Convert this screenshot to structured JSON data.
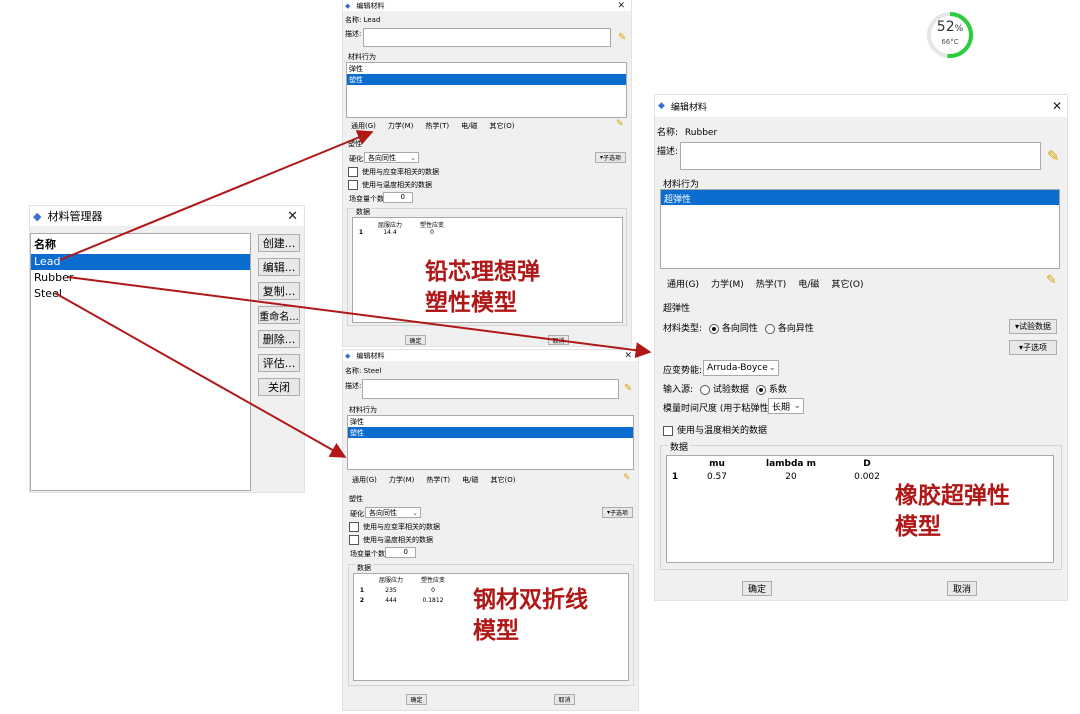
{
  "colors": {
    "selection": "#0a6ccf",
    "annotation": "#b01818",
    "arrow": "#b01818",
    "gauge": "#2ecc40"
  },
  "gauge": {
    "percent_value": 52,
    "percent_unit": "%",
    "temp": "66°C"
  },
  "manager": {
    "title": "材料管理器",
    "header": "名称",
    "items": [
      "Lead",
      "Rubber",
      "Steel"
    ],
    "buttons": [
      "创建...",
      "编辑...",
      "复制...",
      "重命名...",
      "删除...",
      "评估...",
      "关闭"
    ]
  },
  "lead": {
    "title": "编辑材料",
    "name_label": "名称:",
    "name": "Lead",
    "desc_label": "描述:",
    "behavior_label": "材料行为",
    "behaviors": [
      "弹性",
      "塑性"
    ],
    "menus": [
      "通用(G)",
      "力学(M)",
      "热学(T)",
      "电/磁",
      "其它(O)"
    ],
    "section": "塑性",
    "hardening_label": "硬化:",
    "hardening": "各向同性",
    "suboptions": "子选项",
    "cb_strain_rate": "使用与应变率相关的数据",
    "cb_temperature": "使用与温度相关的数据",
    "field_vars_label": "场变量个数:",
    "field_vars": "0",
    "data_label": "数据",
    "columns": [
      "屈服应力",
      "塑性应变"
    ],
    "rows": [
      [
        "1",
        "14.4",
        "0"
      ]
    ],
    "ok": "确定",
    "cancel": "取消",
    "annotation_line1": "铅芯理想弹",
    "annotation_line2": "塑性模型"
  },
  "steel": {
    "title": "编辑材料",
    "name_label": "名称:",
    "name": "Steel",
    "desc_label": "描述:",
    "behavior_label": "材料行为",
    "behaviors": [
      "弹性",
      "塑性"
    ],
    "menus": [
      "通用(G)",
      "力学(M)",
      "热学(T)",
      "电/磁",
      "其它(O)"
    ],
    "section": "塑性",
    "hardening_label": "硬化:",
    "hardening": "各向同性",
    "suboptions": "子选项",
    "cb_strain_rate": "使用与应变率相关的数据",
    "cb_temperature": "使用与温度相关的数据",
    "field_vars_label": "场变量个数:",
    "field_vars": "0",
    "data_label": "数据",
    "columns": [
      "屈服应力",
      "塑性应变"
    ],
    "rows": [
      [
        "1",
        "235",
        "0"
      ],
      [
        "2",
        "444",
        "0.1812"
      ]
    ],
    "ok": "确定",
    "cancel": "取消",
    "annotation_line1": "钢材双折线",
    "annotation_line2": "模型"
  },
  "rubber": {
    "title": "编辑材料",
    "name_label": "名称:",
    "name": "Rubber",
    "desc_label": "描述:",
    "behavior_label": "材料行为",
    "behaviors": [
      "超弹性"
    ],
    "menus": [
      "通用(G)",
      "力学(M)",
      "热学(T)",
      "电/磁",
      "其它(O)"
    ],
    "section": "超弹性",
    "material_type_label": "材料类型:",
    "isotropic": "各向同性",
    "anisotropic": "各向异性",
    "test_data_btn": "试验数据",
    "suboptions": "子选项",
    "strain_energy_label": "应变势能:",
    "strain_energy": "Arruda-Boyce",
    "input_source_label": "输入源:",
    "test_data": "试验数据",
    "coefficients": "系数",
    "moduli_label": "模量时间尺度 (用于粘弹性):",
    "moduli": "长期",
    "cb_temperature": "使用与温度相关的数据",
    "data_label": "数据",
    "columns": [
      "mu",
      "lambda m",
      "D"
    ],
    "rows": [
      [
        "1",
        "0.57",
        "20",
        "0.002"
      ]
    ],
    "ok": "确定",
    "cancel": "取消",
    "annotation_line1": "橡胶超弹性",
    "annotation_line2": "模型"
  }
}
